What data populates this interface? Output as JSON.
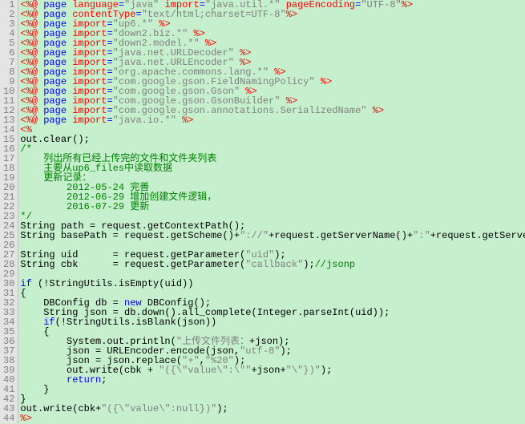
{
  "lines": [
    {
      "n": 1,
      "t": [
        [
          "red",
          "<%@ "
        ],
        [
          "blue",
          "page "
        ],
        [
          "red",
          "language"
        ],
        [
          "blue",
          "="
        ],
        [
          "gray",
          "\"java\""
        ],
        [
          "blue",
          " "
        ],
        [
          "red",
          "import"
        ],
        [
          "blue",
          "="
        ],
        [
          "gray",
          "\"java.util.*\""
        ],
        [
          "blue",
          " "
        ],
        [
          "red",
          "pageEncoding"
        ],
        [
          "blue",
          "="
        ],
        [
          "gray",
          "\"UTF-8\""
        ],
        [
          "red",
          "%>"
        ]
      ]
    },
    {
      "n": 2,
      "t": [
        [
          "red",
          "<%@ "
        ],
        [
          "blue",
          "page "
        ],
        [
          "red",
          "contentType"
        ],
        [
          "blue",
          "="
        ],
        [
          "gray",
          "\"text/html;charset=UTF-8\""
        ],
        [
          "red",
          "%>"
        ]
      ]
    },
    {
      "n": 3,
      "t": [
        [
          "red",
          "<%@ "
        ],
        [
          "blue",
          "page "
        ],
        [
          "red",
          "import"
        ],
        [
          "blue",
          "="
        ],
        [
          "gray",
          "\"up6.*\""
        ],
        [
          "blue",
          " "
        ],
        [
          "red",
          "%>"
        ]
      ]
    },
    {
      "n": 4,
      "t": [
        [
          "red",
          "<%@ "
        ],
        [
          "blue",
          "page "
        ],
        [
          "red",
          "import"
        ],
        [
          "blue",
          "="
        ],
        [
          "gray",
          "\"down2.biz.*\""
        ],
        [
          "blue",
          " "
        ],
        [
          "red",
          "%>"
        ]
      ]
    },
    {
      "n": 5,
      "t": [
        [
          "red",
          "<%@ "
        ],
        [
          "blue",
          "page "
        ],
        [
          "red",
          "import"
        ],
        [
          "blue",
          "="
        ],
        [
          "gray",
          "\"down2.model.*\""
        ],
        [
          "blue",
          " "
        ],
        [
          "red",
          "%>"
        ]
      ]
    },
    {
      "n": 6,
      "t": [
        [
          "red",
          "<%@ "
        ],
        [
          "blue",
          "page "
        ],
        [
          "red",
          "import"
        ],
        [
          "blue",
          "="
        ],
        [
          "gray",
          "\"java.net.URLDecoder\""
        ],
        [
          "blue",
          " "
        ],
        [
          "red",
          "%>"
        ]
      ]
    },
    {
      "n": 7,
      "t": [
        [
          "red",
          "<%@ "
        ],
        [
          "blue",
          "page "
        ],
        [
          "red",
          "import"
        ],
        [
          "blue",
          "="
        ],
        [
          "gray",
          "\"java.net.URLEncoder\""
        ],
        [
          "blue",
          " "
        ],
        [
          "red",
          "%>"
        ]
      ]
    },
    {
      "n": 8,
      "t": [
        [
          "red",
          "<%@ "
        ],
        [
          "blue",
          "page "
        ],
        [
          "red",
          "import"
        ],
        [
          "blue",
          "="
        ],
        [
          "gray",
          "\"org.apache.commons.lang.*\""
        ],
        [
          "blue",
          " "
        ],
        [
          "red",
          "%>"
        ]
      ]
    },
    {
      "n": 9,
      "t": [
        [
          "red",
          "<%@ "
        ],
        [
          "blue",
          "page "
        ],
        [
          "red",
          "import"
        ],
        [
          "blue",
          "="
        ],
        [
          "gray",
          "\"com.google.gson.FieldNamingPolicy\""
        ],
        [
          "blue",
          " "
        ],
        [
          "red",
          "%>"
        ]
      ]
    },
    {
      "n": 10,
      "t": [
        [
          "red",
          "<%@ "
        ],
        [
          "blue",
          "page "
        ],
        [
          "red",
          "import"
        ],
        [
          "blue",
          "="
        ],
        [
          "gray",
          "\"com.google.gson.Gson\""
        ],
        [
          "blue",
          " "
        ],
        [
          "red",
          "%>"
        ]
      ]
    },
    {
      "n": 11,
      "t": [
        [
          "red",
          "<%@ "
        ],
        [
          "blue",
          "page "
        ],
        [
          "red",
          "import"
        ],
        [
          "blue",
          "="
        ],
        [
          "gray",
          "\"com.google.gson.GsonBuilder\""
        ],
        [
          "blue",
          " "
        ],
        [
          "red",
          "%>"
        ]
      ]
    },
    {
      "n": 12,
      "t": [
        [
          "red",
          "<%@ "
        ],
        [
          "blue",
          "page "
        ],
        [
          "red",
          "import"
        ],
        [
          "blue",
          "="
        ],
        [
          "gray",
          "\"com.google.gson.annotations.SerializedName\""
        ],
        [
          "blue",
          " "
        ],
        [
          "red",
          "%>"
        ]
      ]
    },
    {
      "n": 13,
      "t": [
        [
          "red",
          "<%@ "
        ],
        [
          "blue",
          "page "
        ],
        [
          "red",
          "import"
        ],
        [
          "blue",
          "="
        ],
        [
          "gray",
          "\"java.io.*\""
        ],
        [
          "blue",
          " "
        ],
        [
          "red",
          "%>"
        ]
      ]
    },
    {
      "n": 14,
      "t": [
        [
          "red",
          "<%"
        ]
      ]
    },
    {
      "n": 15,
      "t": [
        [
          "black",
          "out.clear();"
        ]
      ]
    },
    {
      "n": 16,
      "t": [
        [
          "green",
          "/*"
        ]
      ]
    },
    {
      "n": 17,
      "t": [
        [
          "green",
          "    列出所有已经上传完的文件和文件夹列表"
        ]
      ]
    },
    {
      "n": 18,
      "t": [
        [
          "green",
          "    主要从up6_files中读取数据"
        ]
      ]
    },
    {
      "n": 19,
      "t": [
        [
          "green",
          "    更新记录："
        ]
      ]
    },
    {
      "n": 20,
      "t": [
        [
          "green",
          "        2012-05-24 完善"
        ]
      ]
    },
    {
      "n": 21,
      "t": [
        [
          "green",
          "        2012-06-29 增加创建文件逻辑，"
        ]
      ]
    },
    {
      "n": 22,
      "t": [
        [
          "green",
          "        2016-07-29 更新"
        ]
      ]
    },
    {
      "n": 23,
      "t": [
        [
          "green",
          "*/"
        ]
      ]
    },
    {
      "n": 24,
      "t": [
        [
          "black",
          "String path = request.getContextPath();"
        ]
      ]
    },
    {
      "n": 25,
      "t": [
        [
          "black",
          "String basePath = request.getScheme()+"
        ],
        [
          "gray",
          "\"://\""
        ],
        [
          "black",
          "+request.getServerName()+"
        ],
        [
          "gray",
          "\":\""
        ],
        [
          "black",
          "+request.getServerPort()+path+"
        ],
        [
          "gray",
          "\"/\""
        ],
        [
          "black",
          ";"
        ]
      ]
    },
    {
      "n": 26,
      "t": [
        [
          "black",
          ""
        ]
      ]
    },
    {
      "n": 27,
      "t": [
        [
          "black",
          "String uid      = request.getParameter("
        ],
        [
          "gray",
          "\"uid\""
        ],
        [
          "black",
          ");"
        ]
      ]
    },
    {
      "n": 28,
      "t": [
        [
          "black",
          "String cbk      = request.getParameter("
        ],
        [
          "gray",
          "\"callback\""
        ],
        [
          "black",
          ");"
        ],
        [
          "green",
          "//jsonp"
        ]
      ]
    },
    {
      "n": 29,
      "t": [
        [
          "black",
          ""
        ]
      ]
    },
    {
      "n": 30,
      "t": [
        [
          "blue",
          "if "
        ],
        [
          "black",
          "(!StringUtils.isEmpty(uid))"
        ]
      ]
    },
    {
      "n": 31,
      "t": [
        [
          "black",
          "{"
        ]
      ]
    },
    {
      "n": 32,
      "t": [
        [
          "black",
          "    DBConfig db = "
        ],
        [
          "blue",
          "new "
        ],
        [
          "black",
          "DBConfig();"
        ]
      ]
    },
    {
      "n": 33,
      "t": [
        [
          "black",
          "    String json = db.down().all_complete(Integer.parseInt(uid));"
        ]
      ]
    },
    {
      "n": 34,
      "t": [
        [
          "black",
          "    "
        ],
        [
          "blue",
          "if"
        ],
        [
          "black",
          "(!StringUtils.isBlank(json))"
        ]
      ]
    },
    {
      "n": 35,
      "t": [
        [
          "black",
          "    {"
        ]
      ]
    },
    {
      "n": 36,
      "t": [
        [
          "black",
          "        System.out.println("
        ],
        [
          "gray",
          "\"上传文件列表："
        ],
        [
          "black",
          "+json);"
        ]
      ]
    },
    {
      "n": 37,
      "t": [
        [
          "black",
          "        json = URLEncoder.encode(json,"
        ],
        [
          "gray",
          "\"utf-8\""
        ],
        [
          "black",
          ");"
        ]
      ]
    },
    {
      "n": 38,
      "t": [
        [
          "black",
          "        json = json.replace("
        ],
        [
          "gray",
          "\"+\""
        ],
        [
          "black",
          ","
        ],
        [
          "gray",
          "\"%20\""
        ],
        [
          "black",
          ");"
        ]
      ]
    },
    {
      "n": 39,
      "t": [
        [
          "black",
          "        out.write(cbk + "
        ],
        [
          "gray",
          "\"({\\\"value\\\":\\\"\""
        ],
        [
          "black",
          "+json+"
        ],
        [
          "gray",
          "\"\\\"})\""
        ],
        [
          "black",
          ");"
        ]
      ]
    },
    {
      "n": 40,
      "t": [
        [
          "black",
          "        "
        ],
        [
          "blue",
          "return"
        ],
        [
          "black",
          ";"
        ]
      ]
    },
    {
      "n": 41,
      "t": [
        [
          "black",
          "    }"
        ]
      ]
    },
    {
      "n": 42,
      "t": [
        [
          "black",
          "}"
        ]
      ]
    },
    {
      "n": 43,
      "t": [
        [
          "black",
          "out.write(cbk+"
        ],
        [
          "gray",
          "\"({\\\"value\\\":null})\""
        ],
        [
          "black",
          ");"
        ]
      ]
    },
    {
      "n": 44,
      "t": [
        [
          "red",
          "%>"
        ]
      ]
    }
  ]
}
